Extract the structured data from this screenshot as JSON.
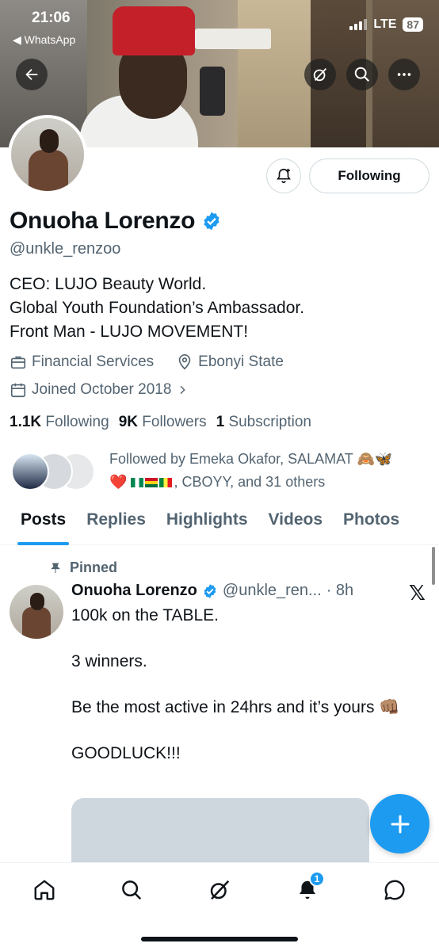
{
  "status_bar": {
    "time": "21:06",
    "back_app": "◀ WhatsApp",
    "network": "LTE",
    "battery": "87"
  },
  "profile": {
    "name": "Onuoha Lorenzo",
    "handle": "@unkle_renzoo",
    "verified": true,
    "bio_lines": [
      "CEO: LUJO Beauty World.",
      "Global Youth Foundation’s Ambassador.",
      "Front Man - LUJO MOVEMENT!"
    ],
    "category": "Financial Services",
    "location": "Ebonyi State",
    "joined": "Joined October 2018",
    "following_button": "Following",
    "stats": {
      "following_count": "1.1K",
      "following_label": "Following",
      "followers_count": "9K",
      "followers_label": "Followers",
      "subscription_count": "1",
      "subscription_label": "Subscription"
    },
    "followed_by_line1": "Followed by Emeka Okafor, SALAMAT 🙈🦋",
    "followed_by_line2_suffix": ", CBOYY, and 31 others"
  },
  "tabs": [
    "Posts",
    "Replies",
    "Highlights",
    "Videos",
    "Photos"
  ],
  "active_tab": "Posts",
  "post": {
    "pinned_label": "Pinned",
    "author": "Onuoha Lorenzo",
    "handle": "@unkle_ren...",
    "time": "· 8h",
    "x_logo": "𝕏",
    "paragraphs": [
      "100k on the TABLE.",
      "3 winners.",
      "Be the most active in 24hrs and it’s yours 👊🏽",
      "GOODLUCK!!!"
    ]
  },
  "bottom_nav": {
    "items": [
      "home-icon",
      "search-icon",
      "grok-icon",
      "notifications-icon",
      "messages-icon"
    ],
    "notification_count": "1"
  },
  "colors": {
    "accent": "#1d9bf0",
    "secondary_text": "#536471",
    "primary_text": "#0f1419"
  }
}
